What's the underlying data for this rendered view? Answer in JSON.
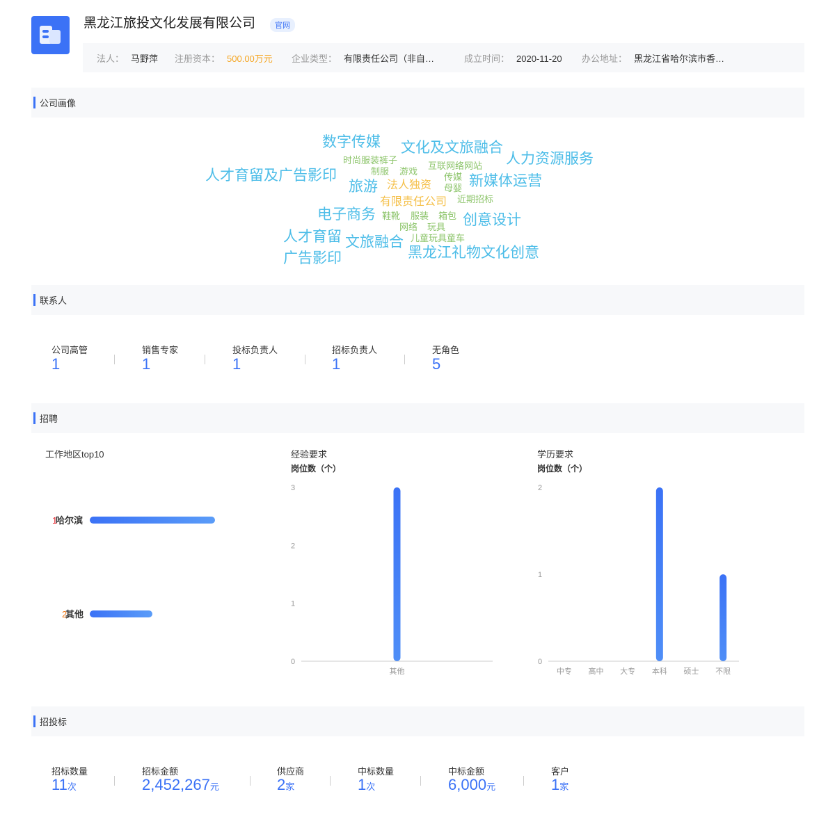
{
  "company": {
    "name": "黑龙江旅投文化发展有限公司",
    "official_tag": "官网",
    "info": [
      {
        "label": "法人：",
        "value": "马野萍"
      },
      {
        "label": "注册资本：",
        "value": "500.00万元"
      },
      {
        "label": "企业类型：",
        "value": "有限责任公司（非自…"
      },
      {
        "label": "成立时间：",
        "value": "2020-11-20"
      },
      {
        "label": "办公地址：",
        "value": "黑龙江省哈尔滨市香…"
      }
    ],
    "colors": {
      "accent": "#3b72f6",
      "capital": "#f5a623"
    }
  },
  "portrait": {
    "title": "公司画像",
    "tags": [
      "数字传媒",
      "文化及文旅融合",
      "人力资源服务",
      "时尚服装裤子",
      "互联网络网站",
      "人才育留及广告影印",
      "制服",
      "游戏",
      "传媒",
      "新媒体运营",
      "旅游",
      "法人独资",
      "母婴",
      "有限责任公司",
      "近期招标",
      "电子商务",
      "鞋靴",
      "服装",
      "箱包",
      "创意设计",
      "网络",
      "玩具",
      "人才育留",
      "文旅融合",
      "儿童玩具童车",
      "黑龙江礼物文化创意",
      "广告影印"
    ],
    "colors": {
      "blue": "#4dbde8",
      "green": "#8cc46a",
      "orange": "#f5c04a"
    }
  },
  "contacts": {
    "title": "联系人",
    "items": [
      {
        "label": "公司高管",
        "value": "1"
      },
      {
        "label": "销售专家",
        "value": "1"
      },
      {
        "label": "投标负责人",
        "value": "1"
      },
      {
        "label": "招标负责人",
        "value": "1"
      },
      {
        "label": "无角色",
        "value": "5"
      }
    ]
  },
  "recruit": {
    "title": "招聘",
    "region": {
      "title": "工作地区top10",
      "items": [
        {
          "rank": "1",
          "name": "哈尔滨",
          "level": 1.0
        },
        {
          "rank": "2",
          "name": "其他",
          "level": 0.5
        }
      ],
      "rank_colors": [
        "#e5242b",
        "#f07a1a"
      ]
    },
    "experience": {
      "title": "经验要求",
      "ylabel": "岗位数（个）"
    },
    "education": {
      "title": "学历要求",
      "ylabel": "岗位数（个）"
    }
  },
  "chart_data": [
    {
      "type": "bar",
      "title": "经验要求",
      "ylabel": "岗位数（个）",
      "categories": [
        "其他"
      ],
      "values": [
        3
      ],
      "ylim": [
        0,
        3
      ],
      "yticks": [
        0,
        1,
        2,
        3
      ]
    },
    {
      "type": "bar",
      "title": "学历要求",
      "ylabel": "岗位数（个）",
      "categories": [
        "中专",
        "高中",
        "大专",
        "本科",
        "硕士",
        "不限"
      ],
      "values": [
        0,
        0,
        0,
        2,
        0,
        1
      ],
      "ylim": [
        0,
        2
      ],
      "yticks": [
        0,
        1,
        2
      ]
    }
  ],
  "bidding": {
    "title": "招投标",
    "items": [
      {
        "label": "招标数量",
        "value": "11",
        "unit": "次"
      },
      {
        "label": "招标金额",
        "value": "2,452,267",
        "unit": "元"
      },
      {
        "label": "供应商",
        "value": "2",
        "unit": "家"
      },
      {
        "label": "中标数量",
        "value": "1",
        "unit": "次"
      },
      {
        "label": "中标金额",
        "value": "6,000",
        "unit": "元"
      },
      {
        "label": "客户",
        "value": "1",
        "unit": "家"
      }
    ]
  }
}
